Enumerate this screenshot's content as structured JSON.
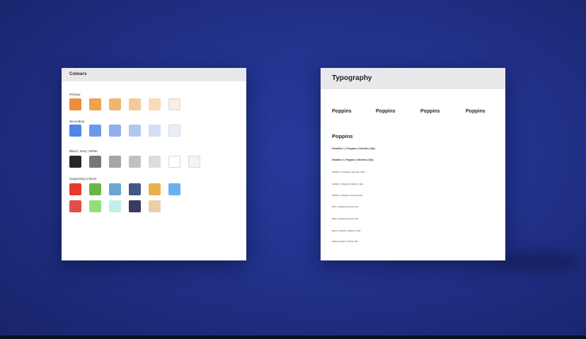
{
  "colours_panel": {
    "title": "Colours",
    "primary": {
      "label": "Primary",
      "swatches": [
        "#ef8d3a",
        "#f0a24f",
        "#f2b570",
        "#f4cb98",
        "#f7dcbc",
        "#fbeede"
      ]
    },
    "secondary": {
      "label": "Secondary",
      "swatches": [
        "#4f86e6",
        "#6c99e9",
        "#8fb0ee",
        "#b1c8f2",
        "#d2dff7",
        "#e8eefb"
      ]
    },
    "neutrals": {
      "label": "Black | Grey | White",
      "swatches": [
        "#26272c",
        "#76777c",
        "#a5a5a8",
        "#c1c1c4",
        "#dcdcdd",
        "#ffffff",
        "#f3f3f4"
      ]
    },
    "supporting": {
      "label": "Supporting Colours",
      "row1": [
        "#e83a2c",
        "#6cb54a",
        "#6aa6d2",
        "#46568b",
        "#e8b24a",
        "#6ab0f0"
      ],
      "row2": [
        "#e04e48",
        "#93e07a",
        "#c3f0e6",
        "#393c5e",
        "#ead0a6"
      ]
    }
  },
  "typography_panel": {
    "title": "Typography",
    "font_samples": [
      "Poppins",
      "Poppins",
      "Poppins",
      "Poppins"
    ],
    "font_name": "Poppins",
    "type_lines": [
      "Headline 1 | Poppins | Normal | 24pt",
      "Headline 2 | Poppins | Medium | 20pt",
      "Subtitle 1 | Poppins | Normal | 16pt",
      "Subtitle 2 | Poppins | Medium | 14pt",
      "Subtitle 3 | Poppins | Normal | 12pt",
      "Body 1 | Poppins | Normal | 14pt",
      "Body 2 | Poppins | Normal | 12pt",
      "Button | Poppins | Medium | 12pt",
      "Caption | Poppins | Normal | 10pt"
    ]
  }
}
